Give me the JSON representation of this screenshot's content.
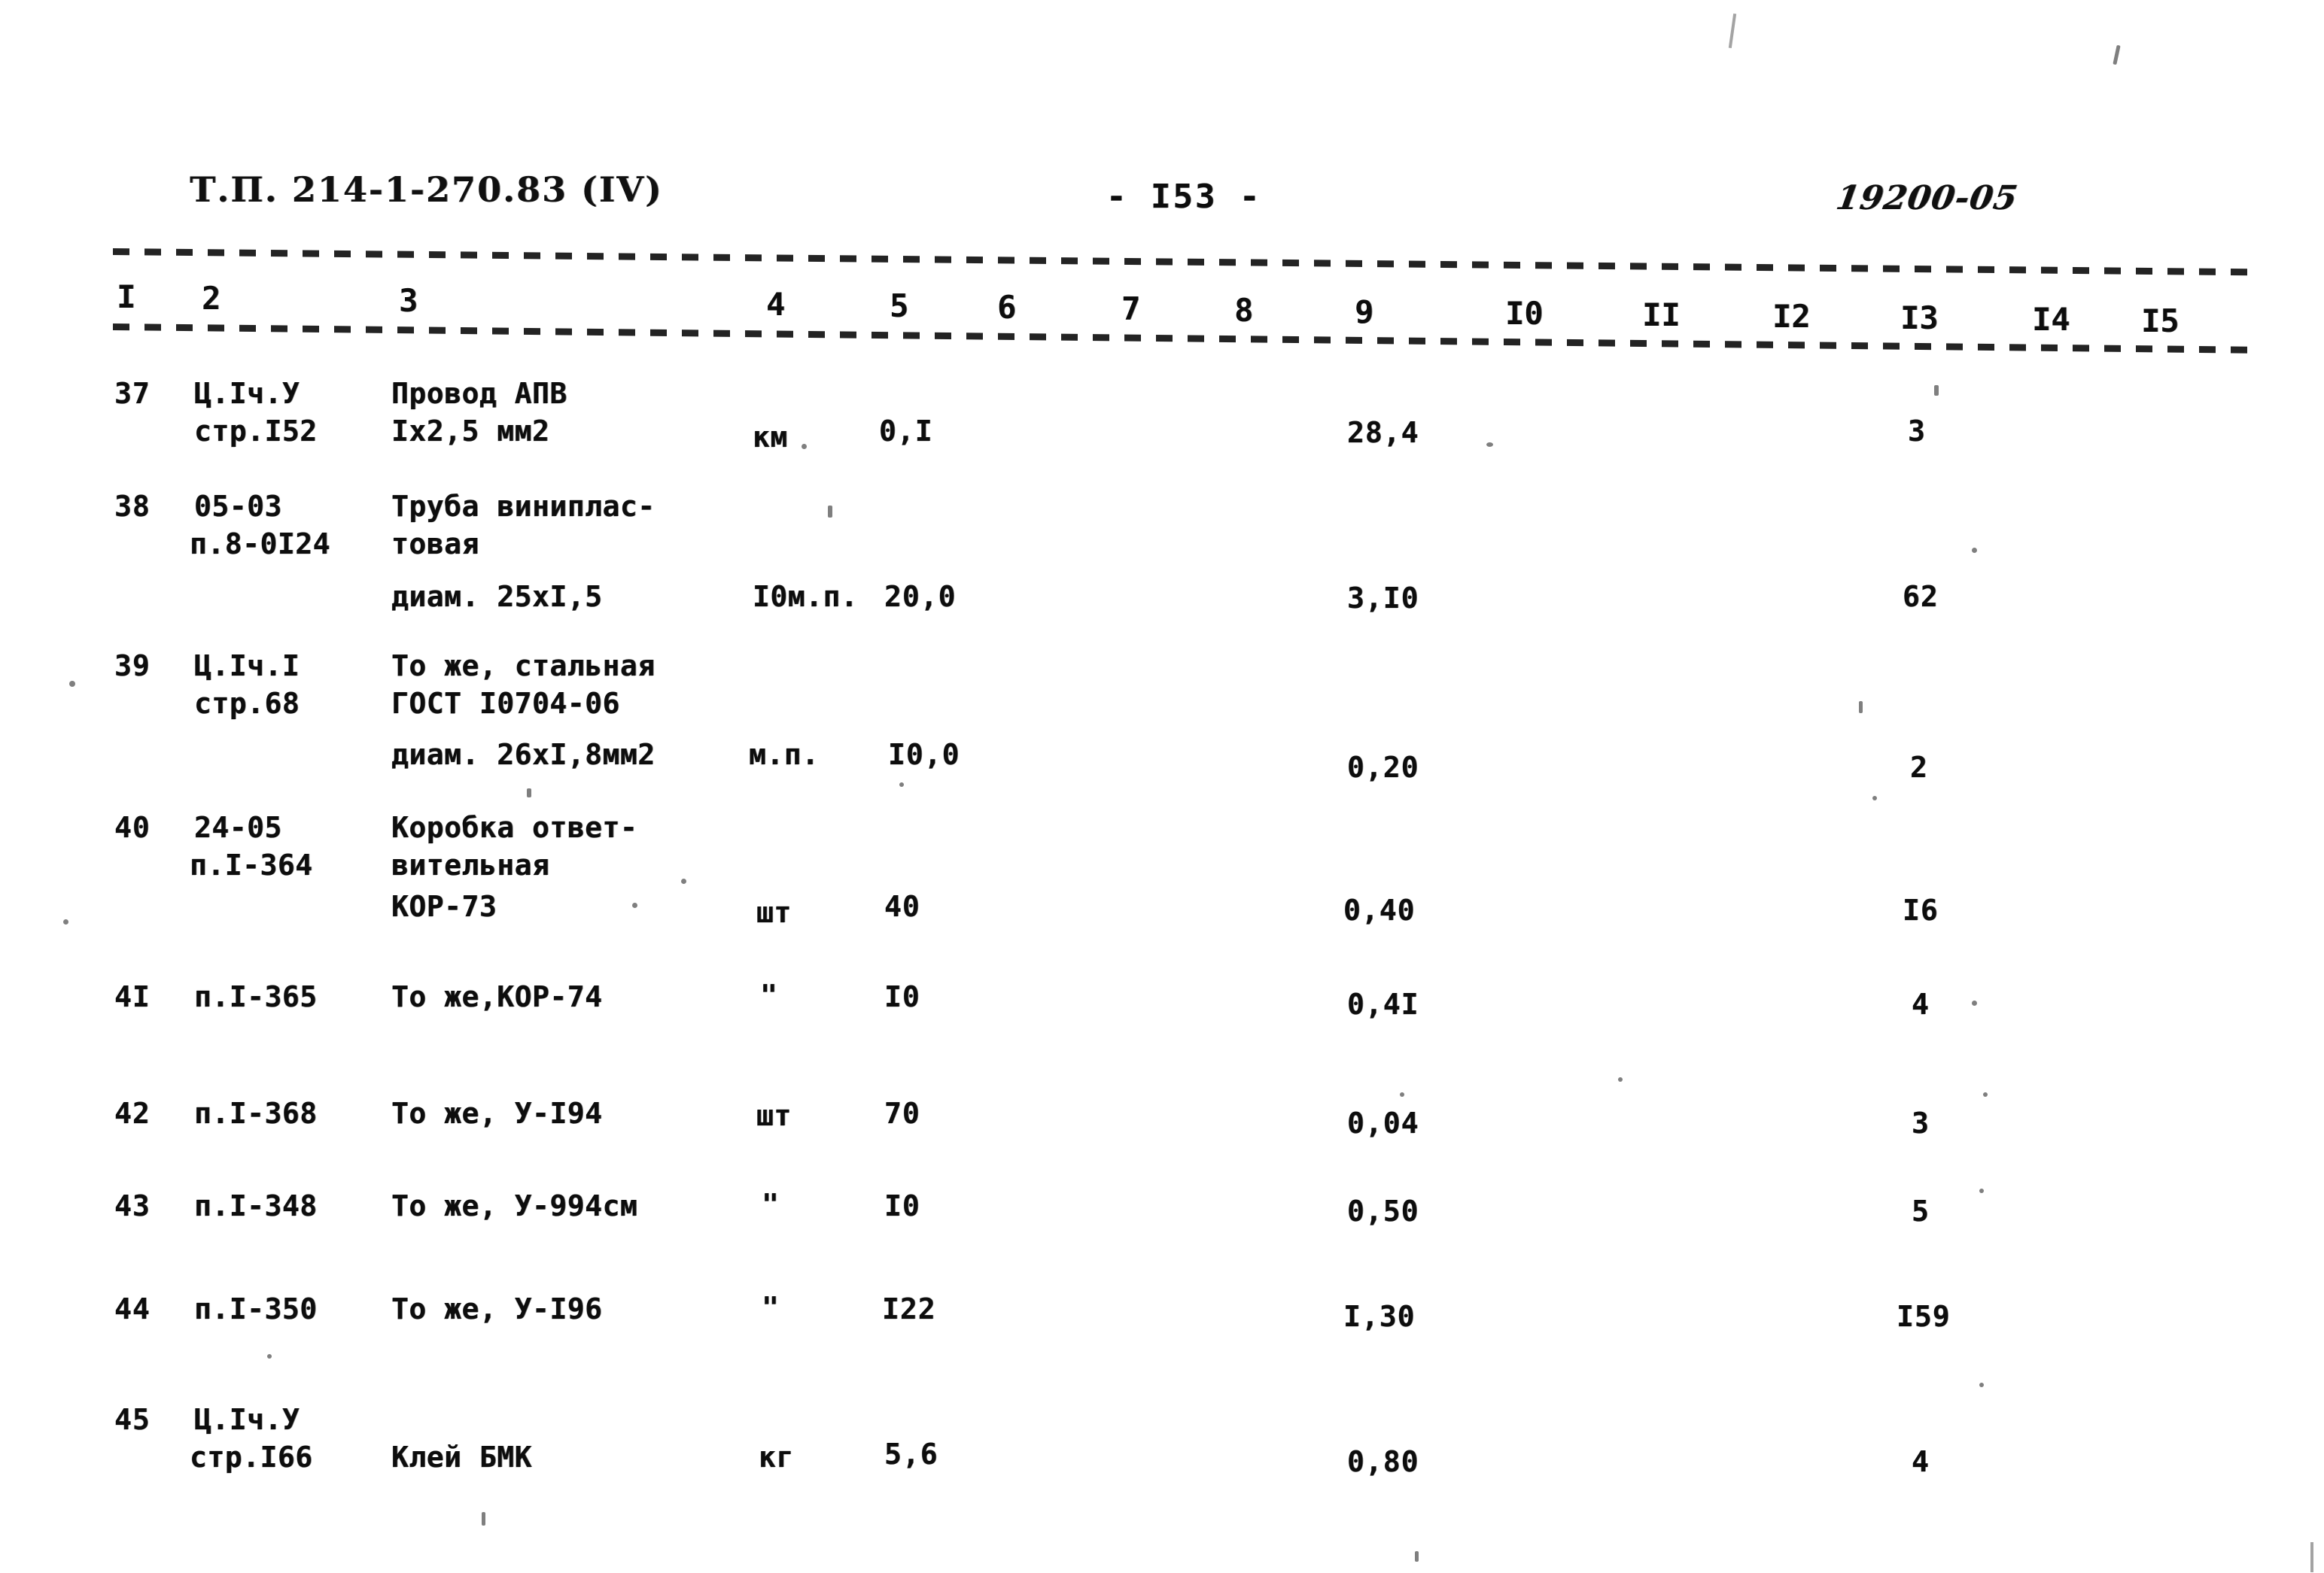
{
  "document": {
    "header_left": "Т.П. 214-1-270.83 (IV)",
    "header_center": "- I53 -",
    "header_right": "19200-05"
  },
  "table": {
    "column_numbers": [
      "I",
      "2",
      "3",
      "4",
      "5",
      "6",
      "7",
      "8",
      "9",
      "I0",
      "II",
      "I2",
      "I3",
      "I4",
      "I5"
    ],
    "rows": [
      {
        "num": "37",
        "code": [
          "Ц.Iч.У",
          "стр.I52"
        ],
        "desc": [
          "Провод АПВ",
          "Iх2,5 мм2"
        ],
        "unit": "км",
        "qty": "0,I",
        "col9": "28,4",
        "col13": "3"
      },
      {
        "num": "38",
        "code": [
          "05-03",
          "п.8-0I24"
        ],
        "desc": [
          "Труба виниплас-",
          "товая",
          "диам. 25хI,5"
        ],
        "unit": "I0м.п.",
        "qty": "20,0",
        "col9": "3,I0",
        "col13": "62"
      },
      {
        "num": "39",
        "code": [
          "Ц.Iч.I",
          "стр.68"
        ],
        "desc": [
          "То же, стальная",
          "ГОСТ I0704-06",
          "диам. 26хI,8мм2"
        ],
        "unit": "м.п.",
        "qty": "I0,0",
        "col9": "0,20",
        "col13": "2"
      },
      {
        "num": "40",
        "code": [
          "24-05",
          "п.I-364"
        ],
        "desc": [
          "Коробка ответ-",
          "вительная",
          "КОР-73"
        ],
        "unit": "шт",
        "qty": "40",
        "col9": "0,40",
        "col13": "I6"
      },
      {
        "num": "4I",
        "code": [
          "п.I-365"
        ],
        "desc": [
          "То же,КОР-74"
        ],
        "unit": "\"",
        "qty": "I0",
        "col9": "0,4I",
        "col13": "4"
      },
      {
        "num": "42",
        "code": [
          "п.I-368"
        ],
        "desc": [
          "То же, У-I94"
        ],
        "unit": "шт",
        "qty": "70",
        "col9": "0,04",
        "col13": "3"
      },
      {
        "num": "43",
        "code": [
          "п.I-348"
        ],
        "desc": [
          "То же, У-994см"
        ],
        "unit": "\"",
        "qty": "I0",
        "col9": "0,50",
        "col13": "5"
      },
      {
        "num": "44",
        "code": [
          "п.I-350"
        ],
        "desc": [
          "То же, У-I96"
        ],
        "unit": "\"",
        "qty": "I22",
        "col9": "I,30",
        "col13": "I59"
      },
      {
        "num": "45",
        "code": [
          "Ц.Iч.У",
          "стр.I66"
        ],
        "desc": [
          "Клей БМК"
        ],
        "unit": "кг",
        "qty": "5,6",
        "col9": "0,80",
        "col13": "4"
      }
    ]
  },
  "colors": {
    "ink": "#0d0d0d",
    "paper": "#ffffff"
  }
}
